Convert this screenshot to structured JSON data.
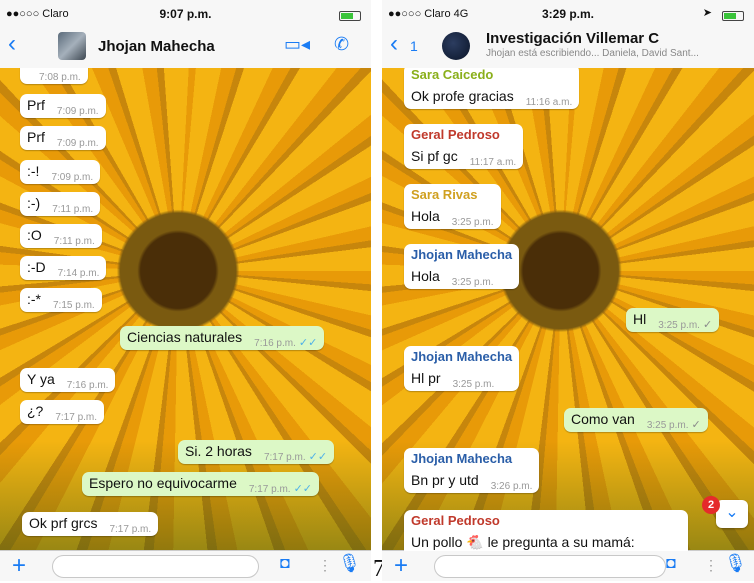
{
  "left": {
    "status": {
      "carrier": "●●○○○ Claro",
      "time": "9:07 p.m."
    },
    "title": "Jhojan Mahecha",
    "messages": [
      {
        "text": "",
        "time": "7:08 p.m.",
        "out": false
      },
      {
        "text": "Prf",
        "time": "7:09 p.m.",
        "out": false
      },
      {
        "text": "Prf",
        "time": "7:09 p.m.",
        "out": false
      },
      {
        "text": ":-!",
        "time": "7:09 p.m.",
        "out": false
      },
      {
        "text": ":-)",
        "time": "7:11 p.m.",
        "out": false
      },
      {
        "text": ":O",
        "time": "7:11 p.m.",
        "out": false
      },
      {
        "text": ":-D",
        "time": "7:14 p.m.",
        "out": false
      },
      {
        "text": ":-*",
        "time": "7:15 p.m.",
        "out": false
      },
      {
        "text": "Ciencias naturales",
        "time": "7:16 p.m.",
        "out": true
      },
      {
        "text": "Y ya",
        "time": "7:16 p.m.",
        "out": false
      },
      {
        "text": "¿?",
        "time": "7:17 p.m.",
        "out": false
      },
      {
        "text": "Si. 2 horas",
        "time": "7:17 p.m.",
        "out": true
      },
      {
        "text": "Espero no equivocarme",
        "time": "7:17 p.m.",
        "out": true
      },
      {
        "text": "Ok prf grcs",
        "time": "7:17 p.m.",
        "out": false
      }
    ]
  },
  "right": {
    "status": {
      "carrier": "●●○○○ Claro  4G",
      "time": "3:29 p.m."
    },
    "back_count": "1",
    "title": "Investigación Villemar C",
    "subtitle": "Jhojan está escribiendo... Daniela, David Sant...",
    "unread_badge": "2",
    "messages": [
      {
        "sender": "Sara Caicedo",
        "sender_color": "#8aaf1a",
        "text": "Ok profe gracias",
        "time": "11:16 a.m.",
        "out": false
      },
      {
        "sender": "Geral  Pedroso",
        "sender_color": "#c0392b",
        "text": "Si pf gc",
        "time": "11:17 a.m.",
        "out": false
      },
      {
        "sender": "Sara Rivas",
        "sender_color": "#d0a020",
        "text": "Hola",
        "time": "3:25 p.m.",
        "out": false
      },
      {
        "sender": "Jhojan Mahecha",
        "sender_color": "#2a5ea8",
        "text": "Hola",
        "time": "3:25 p.m.",
        "out": false
      },
      {
        "sender": "",
        "text": "Hl",
        "time": "3:25 p.m.",
        "out": true
      },
      {
        "sender": "Jhojan Mahecha",
        "sender_color": "#2a5ea8",
        "text": "Hl pr",
        "time": "3:25 p.m.",
        "out": false
      },
      {
        "sender": "",
        "text": "Como van",
        "time": "3:25 p.m.",
        "out": true
      },
      {
        "sender": "Jhojan Mahecha",
        "sender_color": "#2a5ea8",
        "text": "Bn pr y utd",
        "time": "3:26 p.m.",
        "out": false
      },
      {
        "sender": "Geral  Pedroso",
        "sender_color": "#c0392b",
        "text": "Un pollo 🐔 le pregunta a su mamá:",
        "time": "",
        "out": false
      }
    ]
  },
  "figure_number": "7",
  "icons": {
    "back": "chevron-left-icon",
    "video": "video-camera-icon",
    "call": "phone-icon",
    "attach": "plus-icon",
    "camera": "camera-icon",
    "mic": "microphone-icon",
    "scroll": "chevron-down-icon"
  }
}
